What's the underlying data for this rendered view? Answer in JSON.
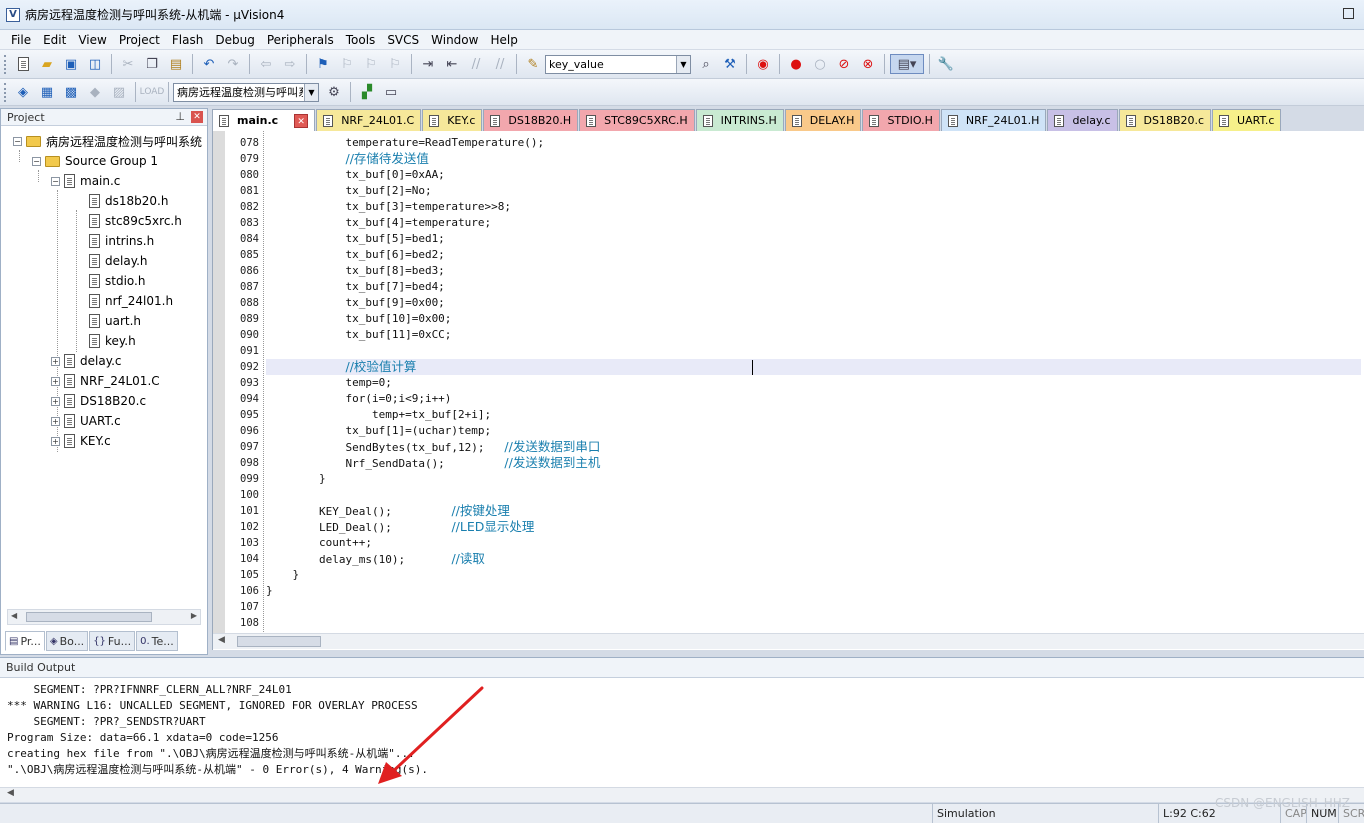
{
  "window": {
    "title": "病房远程温度检测与呼叫系统-从机端 - µVision4"
  },
  "menu": [
    "File",
    "Edit",
    "View",
    "Project",
    "Flash",
    "Debug",
    "Peripherals",
    "Tools",
    "SVCS",
    "Window",
    "Help"
  ],
  "toolbar": {
    "find_combo_value": "key_value",
    "target_combo_value": "病房远程温度检测与呼叫系统"
  },
  "project_panel": {
    "title": "Project",
    "tree": {
      "root": "病房远程温度检测与呼叫系统",
      "group": "Source Group 1",
      "main_file": "main.c",
      "main_includes": [
        "ds18b20.h",
        "stc89c5xrc.h",
        "intrins.h",
        "delay.h",
        "stdio.h",
        "nrf_24l01.h",
        "uart.h",
        "key.h"
      ],
      "other_files": [
        "delay.c",
        "NRF_24L01.C",
        "DS18B20.c",
        "UART.c",
        "KEY.c"
      ]
    },
    "tabs": [
      "Pr...",
      "Bo...",
      "Fu...",
      "Te..."
    ]
  },
  "editor_tabs": [
    {
      "label": "main.c",
      "color": "#ffffff",
      "active": true
    },
    {
      "label": "NRF_24L01.C",
      "color": "#f6e89a"
    },
    {
      "label": "KEY.c",
      "color": "#f6e89a"
    },
    {
      "label": "DS18B20.H",
      "color": "#f2a7ad"
    },
    {
      "label": "STC89C5XRC.H",
      "color": "#f2a7ad"
    },
    {
      "label": "INTRINS.H",
      "color": "#c9ead2"
    },
    {
      "label": "DELAY.H",
      "color": "#f9c98a"
    },
    {
      "label": "STDIO.H",
      "color": "#f2a7ad"
    },
    {
      "label": "NRF_24L01.H",
      "color": "#cfe3f7"
    },
    {
      "label": "delay.c",
      "color": "#c8c0e6"
    },
    {
      "label": "DS18B20.c",
      "color": "#f6e89a"
    },
    {
      "label": "UART.c",
      "color": "#f6f08a"
    }
  ],
  "editor": {
    "lines": [
      {
        "num": "078",
        "code": "            temperature=ReadTemperature();",
        "comment": ""
      },
      {
        "num": "079",
        "code": "            ",
        "comment": "//存储待发送值"
      },
      {
        "num": "080",
        "code": "            tx_buf[0]=0xAA;",
        "comment": ""
      },
      {
        "num": "081",
        "code": "            tx_buf[2]=No;",
        "comment": ""
      },
      {
        "num": "082",
        "code": "            tx_buf[3]=temperature>>8;",
        "comment": ""
      },
      {
        "num": "083",
        "code": "            tx_buf[4]=temperature;",
        "comment": ""
      },
      {
        "num": "084",
        "code": "            tx_buf[5]=bed1;",
        "comment": ""
      },
      {
        "num": "085",
        "code": "            tx_buf[6]=bed2;",
        "comment": ""
      },
      {
        "num": "086",
        "code": "            tx_buf[8]=bed3;",
        "comment": ""
      },
      {
        "num": "087",
        "code": "            tx_buf[7]=bed4;",
        "comment": ""
      },
      {
        "num": "088",
        "code": "            tx_buf[9]=0x00;",
        "comment": ""
      },
      {
        "num": "089",
        "code": "            tx_buf[10]=0x00;",
        "comment": ""
      },
      {
        "num": "090",
        "code": "            tx_buf[11]=0xCC;",
        "comment": ""
      },
      {
        "num": "091",
        "code": "",
        "comment": ""
      },
      {
        "num": "092",
        "code": "            ",
        "comment": "//校验值计算",
        "current": true
      },
      {
        "num": "093",
        "code": "            temp=0;",
        "comment": ""
      },
      {
        "num": "094",
        "code": "            for(i=0;i<9;i++)",
        "comment": ""
      },
      {
        "num": "095",
        "code": "                temp+=tx_buf[2+i];",
        "comment": ""
      },
      {
        "num": "096",
        "code": "            tx_buf[1]=(uchar)temp;",
        "comment": ""
      },
      {
        "num": "097",
        "code": "            SendBytes(tx_buf,12);   ",
        "comment": "//发送数据到串口"
      },
      {
        "num": "098",
        "code": "            Nrf_SendData();         ",
        "comment": "//发送数据到主机"
      },
      {
        "num": "099",
        "code": "        }",
        "comment": ""
      },
      {
        "num": "100",
        "code": "",
        "comment": ""
      },
      {
        "num": "101",
        "code": "        KEY_Deal();         ",
        "comment": "//按键处理"
      },
      {
        "num": "102",
        "code": "        LED_Deal();         ",
        "comment": "//LED显示处理"
      },
      {
        "num": "103",
        "code": "        count++;",
        "comment": ""
      },
      {
        "num": "104",
        "code": "        delay_ms(10);       ",
        "comment": "//读取"
      },
      {
        "num": "105",
        "code": "    }",
        "comment": ""
      },
      {
        "num": "106",
        "code": "}",
        "comment": ""
      },
      {
        "num": "107",
        "code": "",
        "comment": ""
      },
      {
        "num": "108",
        "code": "",
        "comment": ""
      }
    ]
  },
  "build_output": {
    "title": "Build Output",
    "lines": [
      "    SEGMENT: ?PR?IFNNRF_CLERN_ALL?NRF_24L01",
      "*** WARNING L16: UNCALLED SEGMENT, IGNORED FOR OVERLAY PROCESS",
      "    SEGMENT: ?PR?_SENDSTR?UART",
      "Program Size: data=66.1 xdata=0 code=1256",
      "creating hex file from \".\\OBJ\\病房远程温度检测与呼叫系统-从机端\"...",
      "\".\\OBJ\\病房远程温度检测与呼叫系统-从机端\" - 0 Error(s), 4 Warning(s)."
    ]
  },
  "statusbar": {
    "mode": "Simulation",
    "position": "L:92 C:62",
    "cap": "CAP",
    "num": "NUM",
    "scrl": "SCRL"
  },
  "watermark": "CSDN @ENGLISH_HHZ"
}
